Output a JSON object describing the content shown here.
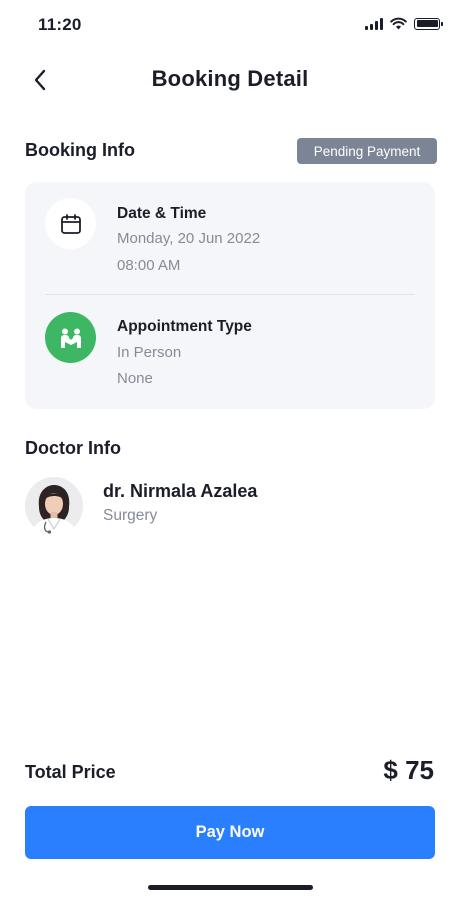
{
  "status_bar": {
    "time": "11:20"
  },
  "header": {
    "title": "Booking Detail"
  },
  "booking_info": {
    "title": "Booking Info",
    "badge": "Pending Payment",
    "date_time": {
      "label": "Date & Time",
      "date": "Monday, 20 Jun 2022",
      "time": "08:00 AM",
      "icon": "calendar-icon"
    },
    "appointment_type": {
      "label": "Appointment Type",
      "type": "In Person",
      "note": "None",
      "icon": "handshake-icon"
    }
  },
  "doctor_info": {
    "title": "Doctor Info",
    "name": "dr. Nirmala Azalea",
    "specialty": "Surgery"
  },
  "footer": {
    "total_label": "Total Price",
    "total_value": "$ 75",
    "pay_label": "Pay Now"
  },
  "colors": {
    "accent": "#2a7fff",
    "badge": "#7c8595",
    "success": "#3db764",
    "muted_text": "#868b97",
    "card_bg": "#f5f6f9"
  }
}
